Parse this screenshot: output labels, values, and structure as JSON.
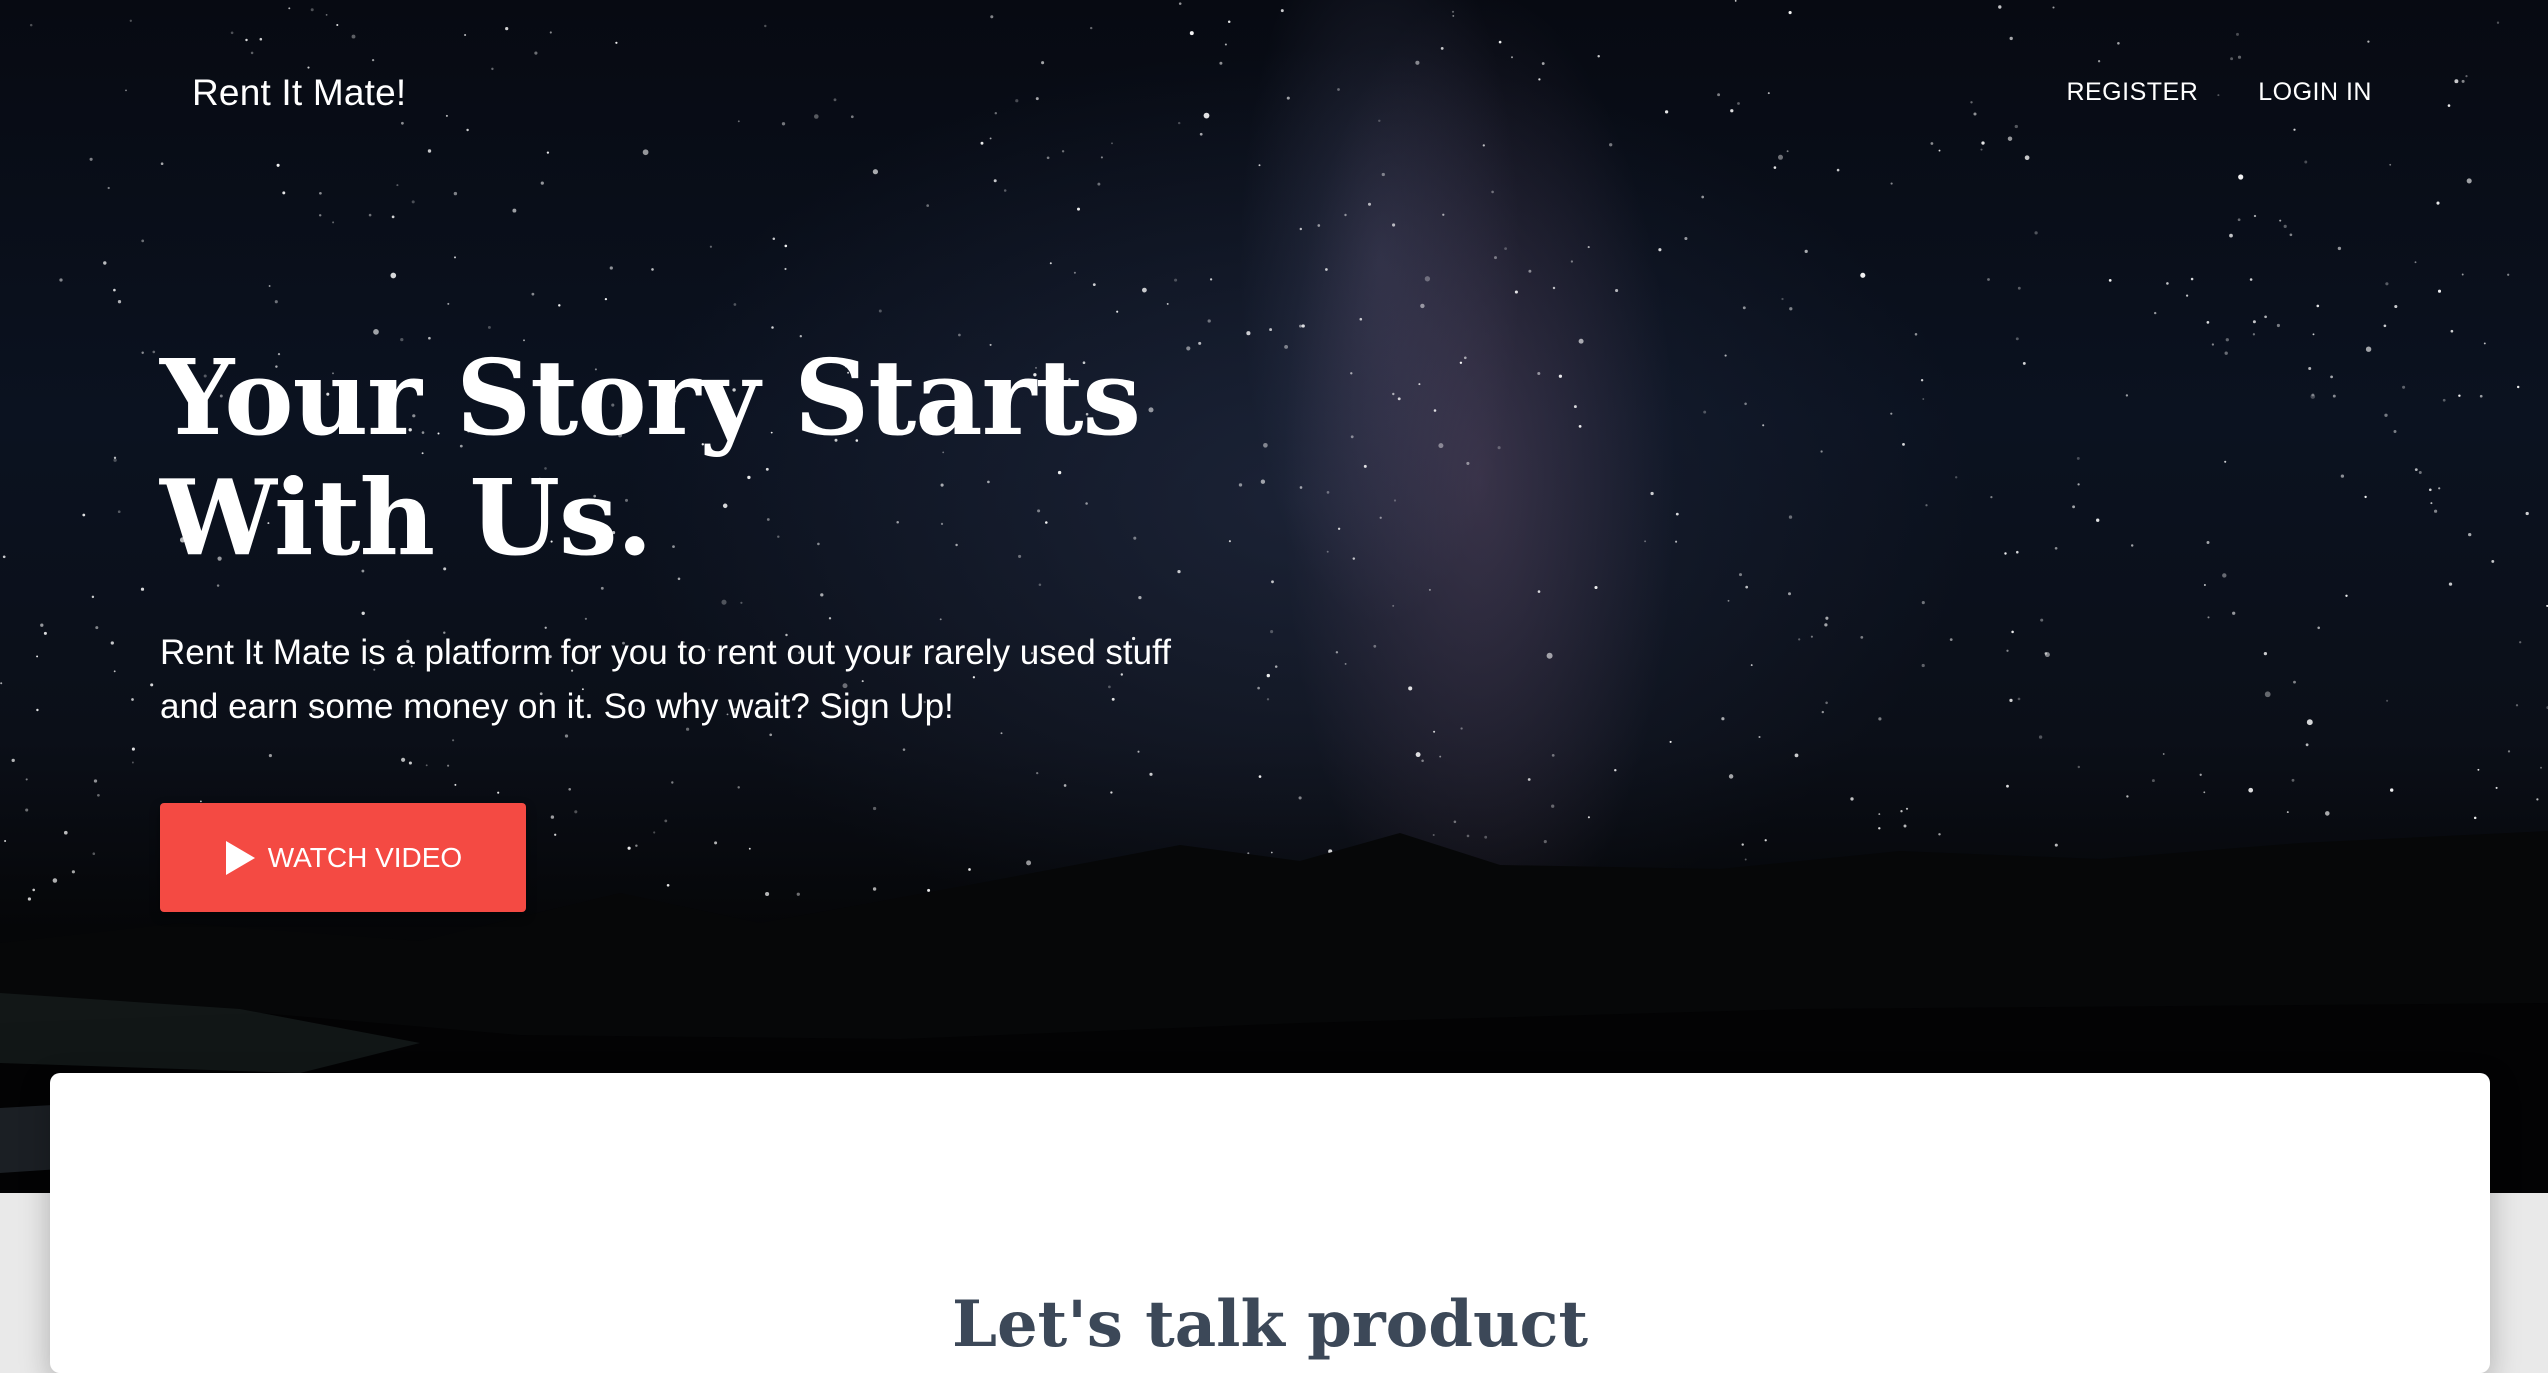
{
  "navbar": {
    "brand": "Rent It Mate!",
    "links": [
      {
        "label": "REGISTER"
      },
      {
        "label": "LOGIN IN"
      }
    ]
  },
  "hero": {
    "title_line1": "Your Story Starts",
    "title_line2": "With Us.",
    "description_line1": "Rent It Mate is a platform for you to rent out your rarely used stuff",
    "description_line2": "and earn some money on it. So why wait? Sign Up!",
    "cta": {
      "label": "WATCH VIDEO",
      "icon": "play-icon",
      "color": "#f44a43"
    }
  },
  "main": {
    "section_title": "Let's talk product"
  },
  "colors": {
    "accent": "#f44a43",
    "heading_dark": "#3c4858",
    "card_bg": "#ffffff",
    "page_bg": "#e9e9e9"
  }
}
